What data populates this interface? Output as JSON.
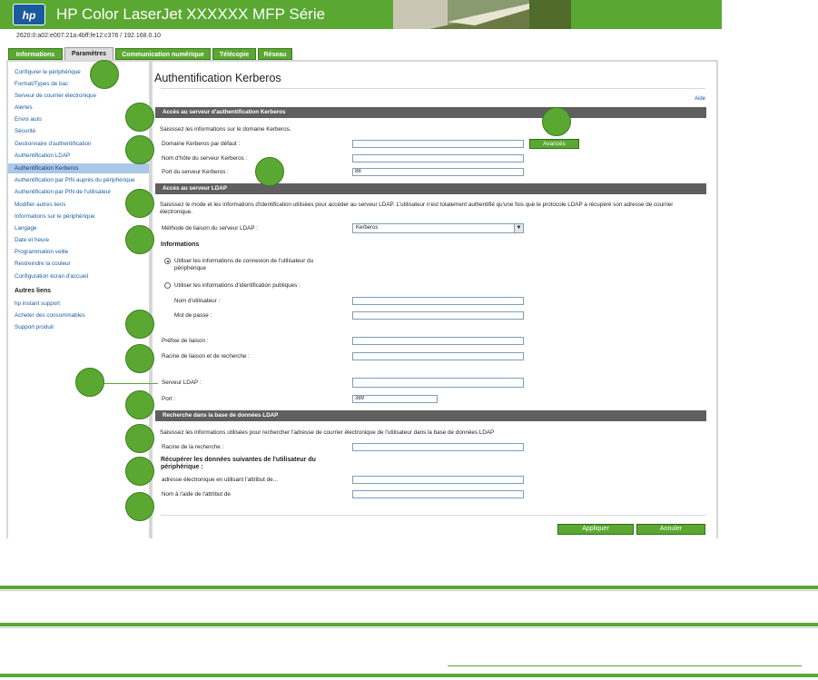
{
  "colors": {
    "brand_green": "#5aa832",
    "section_bar": "#5f5f5f",
    "link_blue": "#1c5a9e",
    "selected_nav": "#a9c7e8"
  },
  "header": {
    "logo": "hp",
    "title": "HP Color LaserJet XXXXXX MFP Série",
    "ip_address": "2620:0:a02:e007:21a:4bff:fe12:c376 / 192.168.0.10"
  },
  "tabs": [
    {
      "label": "Informations",
      "active": false
    },
    {
      "label": "Paramètres",
      "active": true
    },
    {
      "label": "Communication numérique",
      "active": false
    },
    {
      "label": "Télécopie",
      "active": false
    },
    {
      "label": "Réseau",
      "active": false
    }
  ],
  "sidebar": {
    "items": [
      "Configurer le périphérique",
      "Format/Types de bac",
      "Serveur de courrier électronique",
      "Alertes",
      "Envoi auto",
      "Sécurité",
      "Gestionnaire d'authentification",
      "Authentification LDAP",
      "Authentification Kerberos",
      "Authentification par PIN auprès du périphérique",
      "Authentification par PIN de l'utilisateur",
      "Modifier autres liens",
      "Informations sur le périphérique",
      "Langage",
      "Date et heure",
      "Programmation veille",
      "Restreindre la couleur",
      "Configuration écran d'accueil"
    ],
    "selected_index": 8,
    "other_links_header": "Autres liens",
    "other_links": [
      "hp instant support",
      "Acheter des consommables",
      "Support produit"
    ]
  },
  "main": {
    "page_title": "Authentification Kerberos",
    "help_link": "Aide",
    "kerberos": {
      "bar": "Accès au serveur d'authentification Kerberos",
      "intro": "Saisissez les informations sur le domaine Kerberos.",
      "domain_label": "Domaine Kerberos par défaut :",
      "domain_value": "",
      "advanced_button": "Avancés",
      "host_label": "Nom d'hôte du serveur Kerberos :",
      "host_value": "",
      "port_label": "Port du serveur Kerberos :",
      "port_value": "88"
    },
    "ldap_access": {
      "bar": "Accès au serveur LDAP",
      "intro": "Saisissez le mode et les informations d'identification utilisées pour accéder au serveur LDAP. L'utilisateur n'est totalement authentifié qu'une fois que le protocole LDAP a récupéré son adresse de courrier électronique.",
      "bind_method_label": "Méthode de liaison du serveur LDAP :",
      "bind_method_value": "Kerberos",
      "credentials_header": "Informations",
      "option_device_user": "Utiliser les informations de connexion de l'utilisateur du périphérique",
      "option_public": "Utiliser les informations d'identification publiques :",
      "username_label": "Nom d'utilisateur :",
      "username_value": "",
      "password_label": "Mot de passe :",
      "password_value": "",
      "bind_prefix_label": "Préfixe de liaison :",
      "bind_prefix_value": "",
      "bind_root_label": "Racine de liaison et de recherche :",
      "bind_root_value": "",
      "server_label": "Serveur LDAP :",
      "server_value": "",
      "port_label": "Port :",
      "port_value": "389"
    },
    "ldap_search": {
      "bar": "Recherche dans la base de données LDAP",
      "intro": "Saisissez les informations utilisées pour rechercher l'adresse de courrier électronique de l'utilisateur dans la base de données LDAP",
      "search_root_label": "Racine de la recherche :",
      "search_root_value": "",
      "retrieve_header": "Récupérer les données suivantes de l'utilisateur du périphérique :",
      "email_attr_label": "adresse électronique en utilisant l'attribut de...",
      "email_attr_value": "",
      "name_attr_label": "Nom à l'aide de l'attribut de",
      "name_attr_value": ""
    },
    "buttons": {
      "apply": "Appliquer",
      "cancel": "Annuler"
    }
  }
}
